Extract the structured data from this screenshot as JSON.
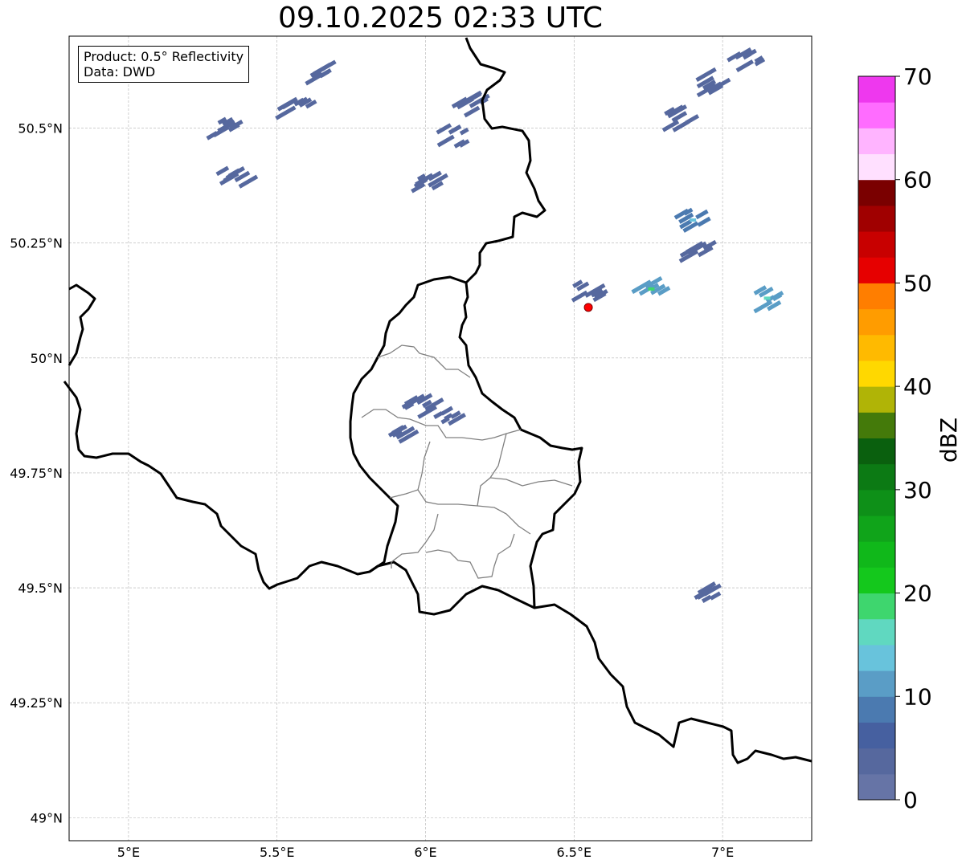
{
  "title": "09.10.2025 02:33 UTC",
  "infobox": {
    "product": "Product: 0.5° Reflectivity",
    "source": "Data: DWD"
  },
  "map": {
    "lon_range": [
      4.8,
      7.3
    ],
    "lat_range": [
      48.95,
      50.7
    ],
    "lon_ticks": [
      {
        "value": 5.0,
        "label": "5°E"
      },
      {
        "value": 5.5,
        "label": "5.5°E"
      },
      {
        "value": 6.0,
        "label": "6°E"
      },
      {
        "value": 6.5,
        "label": "6.5°E"
      },
      {
        "value": 7.0,
        "label": "7°E"
      }
    ],
    "lat_ticks": [
      {
        "value": 49.0,
        "label": "49°N"
      },
      {
        "value": 49.25,
        "label": "49.25°N"
      },
      {
        "value": 49.5,
        "label": "49.5°N"
      },
      {
        "value": 49.75,
        "label": "49.75°N"
      },
      {
        "value": 50.0,
        "label": "50°N"
      },
      {
        "value": 50.25,
        "label": "50.25°N"
      },
      {
        "value": 50.5,
        "label": "50.5°N"
      }
    ],
    "radar_site": {
      "lon": 6.548,
      "lat": 50.11,
      "color": "#ff0000"
    },
    "colors": {
      "border": "#000000",
      "district": "#808080",
      "grid": "#b0b0b0"
    }
  },
  "colorbar": {
    "unit": "dBZ",
    "min": 0,
    "max": 70,
    "step": 2.5,
    "tick_labels": [
      "0",
      "10",
      "20",
      "30",
      "40",
      "50",
      "60",
      "70"
    ],
    "tick_values": [
      0,
      10,
      20,
      30,
      40,
      50,
      60,
      70
    ],
    "colors": [
      "#6674a6",
      "#56689e",
      "#4660a0",
      "#4b7ab0",
      "#5a9dc6",
      "#68c3dc",
      "#60d8c0",
      "#3ed66e",
      "#14c81c",
      "#10b81a",
      "#10a41a",
      "#0e9018",
      "#0c7a14",
      "#0a600e",
      "#447a0a",
      "#b0b406",
      "#ffd800",
      "#ffba00",
      "#ff9c00",
      "#ff7e00",
      "#e60000",
      "#c80000",
      "#a00000",
      "#7a0000",
      "#ffe0ff",
      "#ffb4ff",
      "#ff6cff",
      "#ee38ee"
    ]
  },
  "echoes": [
    {
      "lon": 5.66,
      "lat": 50.62,
      "dbz": 3
    },
    {
      "lon": 5.57,
      "lat": 50.55,
      "dbz": 3
    },
    {
      "lon": 5.32,
      "lat": 50.5,
      "dbz": 3
    },
    {
      "lon": 5.36,
      "lat": 50.4,
      "dbz": 3
    },
    {
      "lon": 6.16,
      "lat": 50.55,
      "dbz": 3
    },
    {
      "lon": 6.1,
      "lat": 50.48,
      "dbz": 3
    },
    {
      "lon": 6.02,
      "lat": 50.38,
      "dbz": 3
    },
    {
      "lon": 6.86,
      "lat": 50.52,
      "dbz": 3
    },
    {
      "lon": 6.95,
      "lat": 50.6,
      "dbz": 3
    },
    {
      "lon": 7.08,
      "lat": 50.65,
      "dbz": 3
    },
    {
      "lon": 6.9,
      "lat": 50.3,
      "dbz": 8
    },
    {
      "lon": 6.92,
      "lat": 50.23,
      "dbz": 3
    },
    {
      "lon": 6.55,
      "lat": 50.15,
      "dbz": 3
    },
    {
      "lon": 6.76,
      "lat": 50.15,
      "dbz": 12
    },
    {
      "lon": 7.15,
      "lat": 50.13,
      "dbz": 10
    },
    {
      "lon": 5.99,
      "lat": 49.9,
      "dbz": 3
    },
    {
      "lon": 6.06,
      "lat": 49.88,
      "dbz": 3
    },
    {
      "lon": 5.94,
      "lat": 49.83,
      "dbz": 3
    },
    {
      "lon": 6.95,
      "lat": 49.49,
      "dbz": 3
    }
  ]
}
